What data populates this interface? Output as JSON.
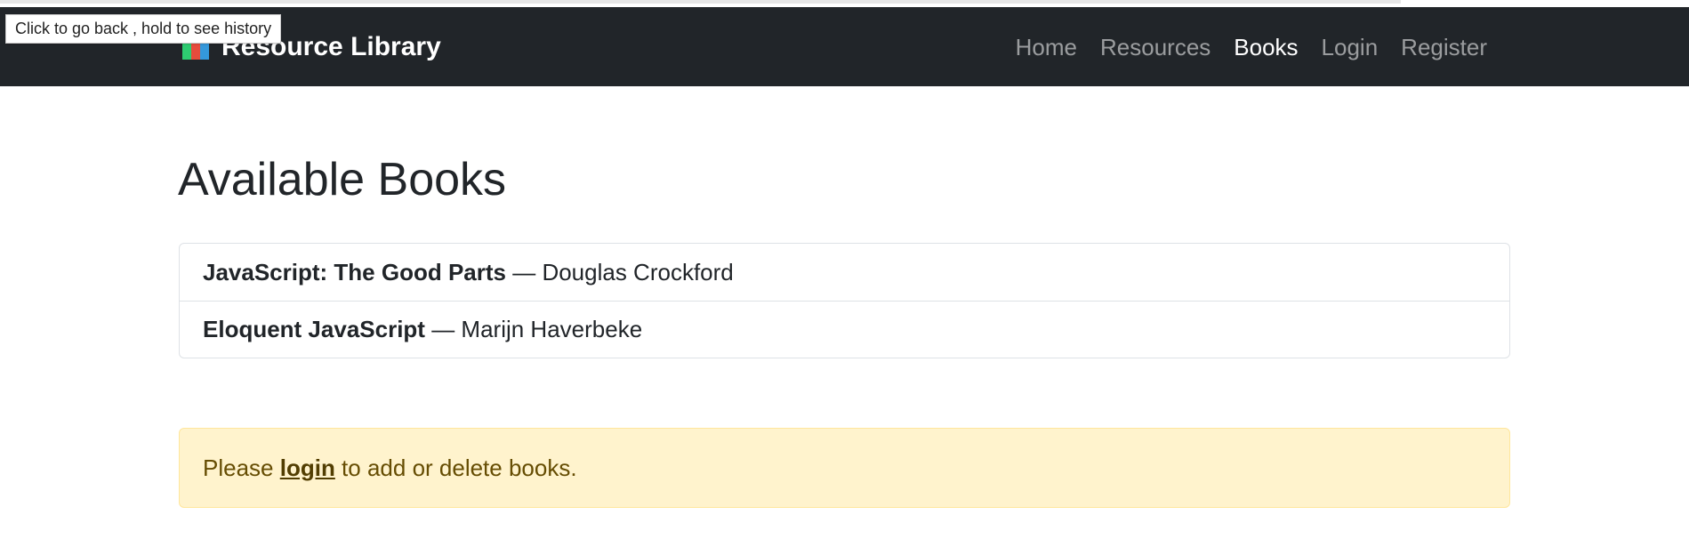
{
  "tooltip": {
    "text": "Click to go back , hold to see history"
  },
  "navbar": {
    "brand": "Resource Library",
    "links": [
      {
        "label": "Home",
        "active": false
      },
      {
        "label": "Resources",
        "active": false
      },
      {
        "label": "Books",
        "active": true
      },
      {
        "label": "Login",
        "active": false
      },
      {
        "label": "Register",
        "active": false
      }
    ]
  },
  "main": {
    "title": "Available Books",
    "books": [
      {
        "title": "JavaScript: The Good Parts",
        "separator": " — ",
        "author": "Douglas Crockford"
      },
      {
        "title": "Eloquent JavaScript",
        "separator": " — ",
        "author": "Marijn Haverbeke"
      }
    ],
    "alert": {
      "prefix": "Please ",
      "link": "login",
      "suffix": " to add or delete books."
    }
  },
  "colors": {
    "navbar_bg": "#212529",
    "alert_bg": "#fff3cd",
    "alert_text": "#664d03"
  }
}
